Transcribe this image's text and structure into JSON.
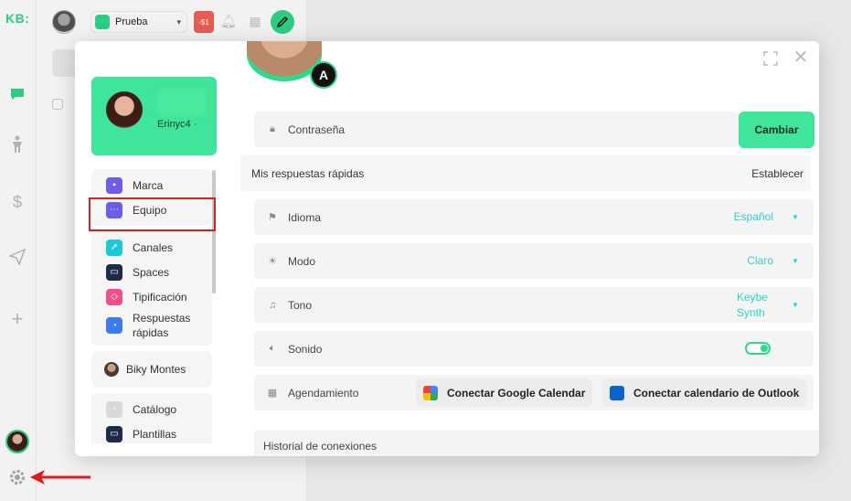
{
  "app": {
    "logo": "KB:"
  },
  "topbar": {
    "workspace_label": "Prueba",
    "alert_badge": "-$1"
  },
  "profile": {
    "username": "Erinyc4 ·",
    "badge_letter": "A"
  },
  "settings_nav": {
    "groups": [
      [
        {
          "label": "Marca",
          "icon": "briefcase-icon",
          "color": "#6d5ce8"
        },
        {
          "label": "Equipo",
          "icon": "team-icon",
          "color": "#6d5ce8"
        }
      ],
      [
        {
          "label": "Canales",
          "icon": "rocket-icon",
          "color": "#1cc7d6"
        },
        {
          "label": "Spaces",
          "icon": "spaces-icon",
          "color": "#1e2a4a"
        },
        {
          "label": "Tipificación",
          "icon": "tag-icon",
          "color": "#ef4f8a"
        },
        {
          "label": "Respuestas rápidas",
          "icon": "quick-reply-icon",
          "color": "#3a7bef"
        }
      ]
    ],
    "user_label": "Biky Montes",
    "catalog_items": [
      {
        "label": "Catálogo",
        "icon": "catalog-icon",
        "color": "#d8d8d8"
      },
      {
        "label": "Plantillas",
        "icon": "template-icon",
        "color": "#1e2a4a"
      }
    ]
  },
  "settings": {
    "password": {
      "label": "Contraseña",
      "button": "Cambiar"
    },
    "quick_replies": {
      "label": "Mis respuestas rápidas",
      "action": "Establecer"
    },
    "language": {
      "label": "Idioma",
      "value": "Español"
    },
    "mode": {
      "label": "Modo",
      "value": "Claro"
    },
    "tone": {
      "label": "Tono",
      "value": "Keybe Synth"
    },
    "sound": {
      "label": "Sonido",
      "enabled": true
    },
    "scheduling": {
      "label": "Agendamiento",
      "google_button": "Conectar Google Calendar",
      "outlook_button": "Conectar calendario de Outlook"
    },
    "history": {
      "label": "Historial de conexiones"
    }
  },
  "colors": {
    "accent": "#3ee59a",
    "link": "#2fcfcf",
    "annotation": "#d71f1f"
  }
}
